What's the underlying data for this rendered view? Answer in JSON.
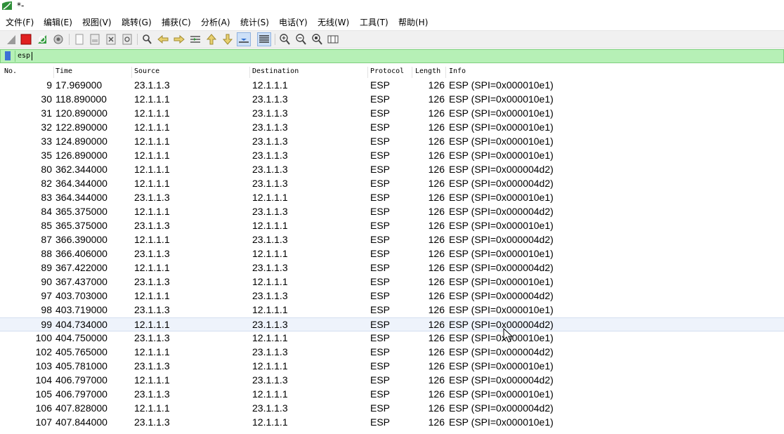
{
  "window": {
    "title": "*-"
  },
  "menubar": {
    "items": [
      {
        "label": "文件(F)"
      },
      {
        "label": "编辑(E)"
      },
      {
        "label": "视图(V)"
      },
      {
        "label": "跳转(G)"
      },
      {
        "label": "捕获(C)"
      },
      {
        "label": "分析(A)"
      },
      {
        "label": "统计(S)"
      },
      {
        "label": "电话(Y)"
      },
      {
        "label": "无线(W)"
      },
      {
        "label": "工具(T)"
      },
      {
        "label": "帮助(H)"
      }
    ]
  },
  "toolbar": {
    "icons": [
      "start-capture-icon",
      "stop-capture-icon",
      "restart-capture-icon",
      "capture-options-icon",
      "open-file-icon",
      "save-file-icon",
      "close-file-icon",
      "reload-icon",
      "find-packet-icon",
      "go-back-icon",
      "go-forward-icon",
      "go-to-packet-icon",
      "first-packet-icon",
      "last-packet-icon",
      "auto-scroll-icon",
      "colorize-icon",
      "zoom-in-icon",
      "zoom-out-icon",
      "zoom-normal-icon",
      "resize-columns-icon"
    ]
  },
  "filter": {
    "value": "esp"
  },
  "packet_list": {
    "columns": [
      "No.",
      "Time",
      "Source",
      "Destination",
      "Protocol",
      "Length",
      "Info"
    ],
    "rows": [
      {
        "no": "9",
        "time": "17.969000",
        "src": "23.1.1.3",
        "dst": "12.1.1.1",
        "proto": "ESP",
        "len": "126",
        "info": "ESP (SPI=0x000010e1)"
      },
      {
        "no": "30",
        "time": "118.890000",
        "src": "12.1.1.1",
        "dst": "23.1.1.3",
        "proto": "ESP",
        "len": "126",
        "info": "ESP (SPI=0x000010e1)"
      },
      {
        "no": "31",
        "time": "120.890000",
        "src": "12.1.1.1",
        "dst": "23.1.1.3",
        "proto": "ESP",
        "len": "126",
        "info": "ESP (SPI=0x000010e1)"
      },
      {
        "no": "32",
        "time": "122.890000",
        "src": "12.1.1.1",
        "dst": "23.1.1.3",
        "proto": "ESP",
        "len": "126",
        "info": "ESP (SPI=0x000010e1)"
      },
      {
        "no": "33",
        "time": "124.890000",
        "src": "12.1.1.1",
        "dst": "23.1.1.3",
        "proto": "ESP",
        "len": "126",
        "info": "ESP (SPI=0x000010e1)"
      },
      {
        "no": "35",
        "time": "126.890000",
        "src": "12.1.1.1",
        "dst": "23.1.1.3",
        "proto": "ESP",
        "len": "126",
        "info": "ESP (SPI=0x000010e1)"
      },
      {
        "no": "80",
        "time": "362.344000",
        "src": "12.1.1.1",
        "dst": "23.1.1.3",
        "proto": "ESP",
        "len": "126",
        "info": "ESP (SPI=0x000004d2)"
      },
      {
        "no": "82",
        "time": "364.344000",
        "src": "12.1.1.1",
        "dst": "23.1.1.3",
        "proto": "ESP",
        "len": "126",
        "info": "ESP (SPI=0x000004d2)"
      },
      {
        "no": "83",
        "time": "364.344000",
        "src": "23.1.1.3",
        "dst": "12.1.1.1",
        "proto": "ESP",
        "len": "126",
        "info": "ESP (SPI=0x000010e1)"
      },
      {
        "no": "84",
        "time": "365.375000",
        "src": "12.1.1.1",
        "dst": "23.1.1.3",
        "proto": "ESP",
        "len": "126",
        "info": "ESP (SPI=0x000004d2)"
      },
      {
        "no": "85",
        "time": "365.375000",
        "src": "23.1.1.3",
        "dst": "12.1.1.1",
        "proto": "ESP",
        "len": "126",
        "info": "ESP (SPI=0x000010e1)"
      },
      {
        "no": "87",
        "time": "366.390000",
        "src": "12.1.1.1",
        "dst": "23.1.1.3",
        "proto": "ESP",
        "len": "126",
        "info": "ESP (SPI=0x000004d2)"
      },
      {
        "no": "88",
        "time": "366.406000",
        "src": "23.1.1.3",
        "dst": "12.1.1.1",
        "proto": "ESP",
        "len": "126",
        "info": "ESP (SPI=0x000010e1)"
      },
      {
        "no": "89",
        "time": "367.422000",
        "src": "12.1.1.1",
        "dst": "23.1.1.3",
        "proto": "ESP",
        "len": "126",
        "info": "ESP (SPI=0x000004d2)"
      },
      {
        "no": "90",
        "time": "367.437000",
        "src": "23.1.1.3",
        "dst": "12.1.1.1",
        "proto": "ESP",
        "len": "126",
        "info": "ESP (SPI=0x000010e1)"
      },
      {
        "no": "97",
        "time": "403.703000",
        "src": "12.1.1.1",
        "dst": "23.1.1.3",
        "proto": "ESP",
        "len": "126",
        "info": "ESP (SPI=0x000004d2)"
      },
      {
        "no": "98",
        "time": "403.719000",
        "src": "23.1.1.3",
        "dst": "12.1.1.1",
        "proto": "ESP",
        "len": "126",
        "info": "ESP (SPI=0x000010e1)"
      },
      {
        "no": "99",
        "time": "404.734000",
        "src": "12.1.1.1",
        "dst": "23.1.1.3",
        "proto": "ESP",
        "len": "126",
        "info": "ESP (SPI=0x000004d2)",
        "selected": true
      },
      {
        "no": "100",
        "time": "404.750000",
        "src": "23.1.1.3",
        "dst": "12.1.1.1",
        "proto": "ESP",
        "len": "126",
        "info": "ESP (SPI=0x000010e1)"
      },
      {
        "no": "102",
        "time": "405.765000",
        "src": "12.1.1.1",
        "dst": "23.1.1.3",
        "proto": "ESP",
        "len": "126",
        "info": "ESP (SPI=0x000004d2)"
      },
      {
        "no": "103",
        "time": "405.781000",
        "src": "23.1.1.3",
        "dst": "12.1.1.1",
        "proto": "ESP",
        "len": "126",
        "info": "ESP (SPI=0x000010e1)"
      },
      {
        "no": "104",
        "time": "406.797000",
        "src": "12.1.1.1",
        "dst": "23.1.1.3",
        "proto": "ESP",
        "len": "126",
        "info": "ESP (SPI=0x000004d2)"
      },
      {
        "no": "105",
        "time": "406.797000",
        "src": "23.1.1.3",
        "dst": "12.1.1.1",
        "proto": "ESP",
        "len": "126",
        "info": "ESP (SPI=0x000010e1)"
      },
      {
        "no": "106",
        "time": "407.828000",
        "src": "12.1.1.1",
        "dst": "23.1.1.3",
        "proto": "ESP",
        "len": "126",
        "info": "ESP (SPI=0x000004d2)"
      },
      {
        "no": "107",
        "time": "407.844000",
        "src": "23.1.1.3",
        "dst": "12.1.1.1",
        "proto": "ESP",
        "len": "126",
        "info": "ESP (SPI=0x000010e1)"
      }
    ]
  },
  "colors": {
    "filter_valid_bg": "#b6f0b6",
    "selected_row_bg": "#eef3fb",
    "accent_blue": "#3d6fd6"
  }
}
